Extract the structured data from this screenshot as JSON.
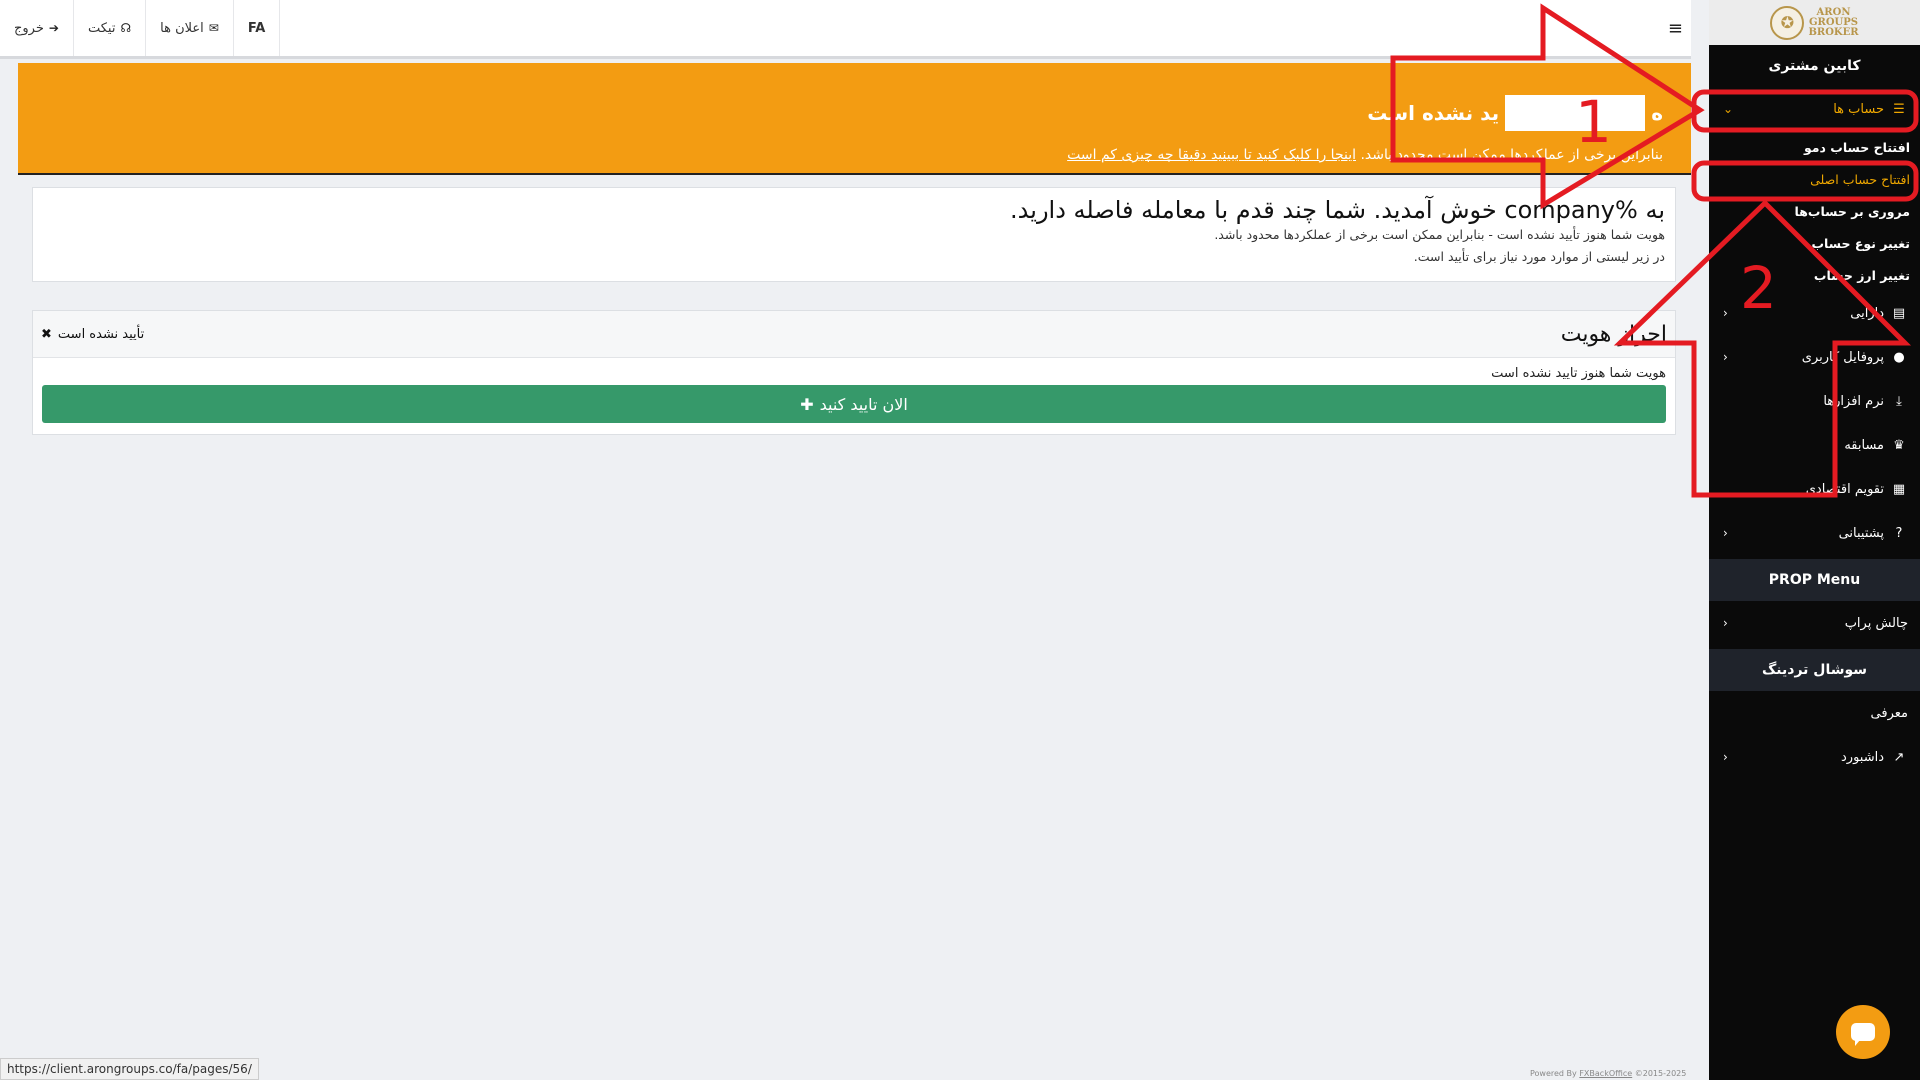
{
  "topbar": {
    "items": [
      {
        "label": "خروج",
        "icon": "sign-out-icon"
      },
      {
        "label": "تیکت",
        "icon": "headset-icon"
      },
      {
        "label": "اعلان ها",
        "icon": "envelope-icon"
      }
    ],
    "lang": "FA"
  },
  "sidebar": {
    "logo_text": [
      "ARON",
      "GROUPS",
      "BROKER"
    ],
    "header": "کابین مشتری",
    "accounts": {
      "label": "حساب ها",
      "subitems": [
        "افتتاح حساب دمو",
        "افتتاح حساب اصلی",
        "مروری بر حساب‌ها",
        "تغییر نوع حساب",
        "تغییر ارز حساب"
      ]
    },
    "items": [
      {
        "label": "دارایی"
      },
      {
        "label": "پروفایل کاربری"
      },
      {
        "label": "نرم افزارها"
      },
      {
        "label": "مسابقه"
      },
      {
        "label": "تقویم اقتصادی"
      },
      {
        "label": "پشتیبانی"
      }
    ],
    "prop_menu": {
      "title": "PROP Menu",
      "items": [
        "چالش پراپ"
      ]
    },
    "social": {
      "title": "سوشال تردینگ",
      "items": [
        "معرفی",
        "داشبورد"
      ]
    }
  },
  "banner": {
    "title_start": "ه",
    "title_end": "ید نشده است",
    "text": "بنابراین برخی از عملکردها ممکن است محدود باشد.",
    "link": "اینجا را کلیک کنید تا ببینید دقیقا چه چیزی کم است"
  },
  "welcome": {
    "title": "به %company خوش آمدید. شما چند قدم با معامله فاصله دارید.",
    "line1": "هویت شما هنوز تأیید نشده است - بنابراین ممکن است برخی از عملکردها محدود باشد.",
    "line2": "در زیر لیستی از موارد مورد نیاز برای تأیید است."
  },
  "verify": {
    "title": "احراز هویت",
    "status": "تأیید نشده است",
    "message": "هویت شما هنوز تایید نشده است",
    "button": "الان تایید کنید"
  },
  "footer": {
    "status_url": "https://client.arongroups.co/fa/pages/56/",
    "powered_prefix": "Powered By",
    "powered_link": "FXBackOffice",
    "powered_suffix": "©2015-2025"
  },
  "annotations": [
    "1",
    "2"
  ],
  "colors": {
    "accent": "#f39c12",
    "active": "#f0a800",
    "success": "#36996a",
    "annotation": "#e41b22"
  }
}
